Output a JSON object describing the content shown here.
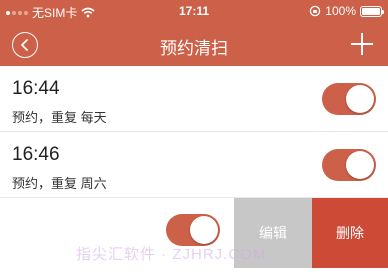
{
  "status_bar": {
    "carrier": "无SIM卡",
    "time": "17:11",
    "battery": "100%",
    "icons": [
      "signal-icon",
      "wifi-icon",
      "orientation-lock-icon",
      "battery-icon"
    ]
  },
  "header": {
    "title": "预约清扫",
    "back_icon": "chevron-left-circle-icon",
    "add_icon": "plus-icon",
    "background": "#cc6048"
  },
  "schedules": [
    {
      "time": "16:44",
      "description": "预约，重复 每天",
      "enabled": true
    },
    {
      "time": "16:46",
      "description": "预约，重复 周六",
      "enabled": true
    },
    {
      "time": "",
      "description": "",
      "enabled": true
    }
  ],
  "swipe_actions": {
    "edit_label": "编辑",
    "delete_label": "删除",
    "edit_color": "#c7c7c7",
    "delete_color": "#cc4a36"
  },
  "accent_color": "#cc6048",
  "watermark": "指尖汇软件 · ZJHRJ.COM"
}
